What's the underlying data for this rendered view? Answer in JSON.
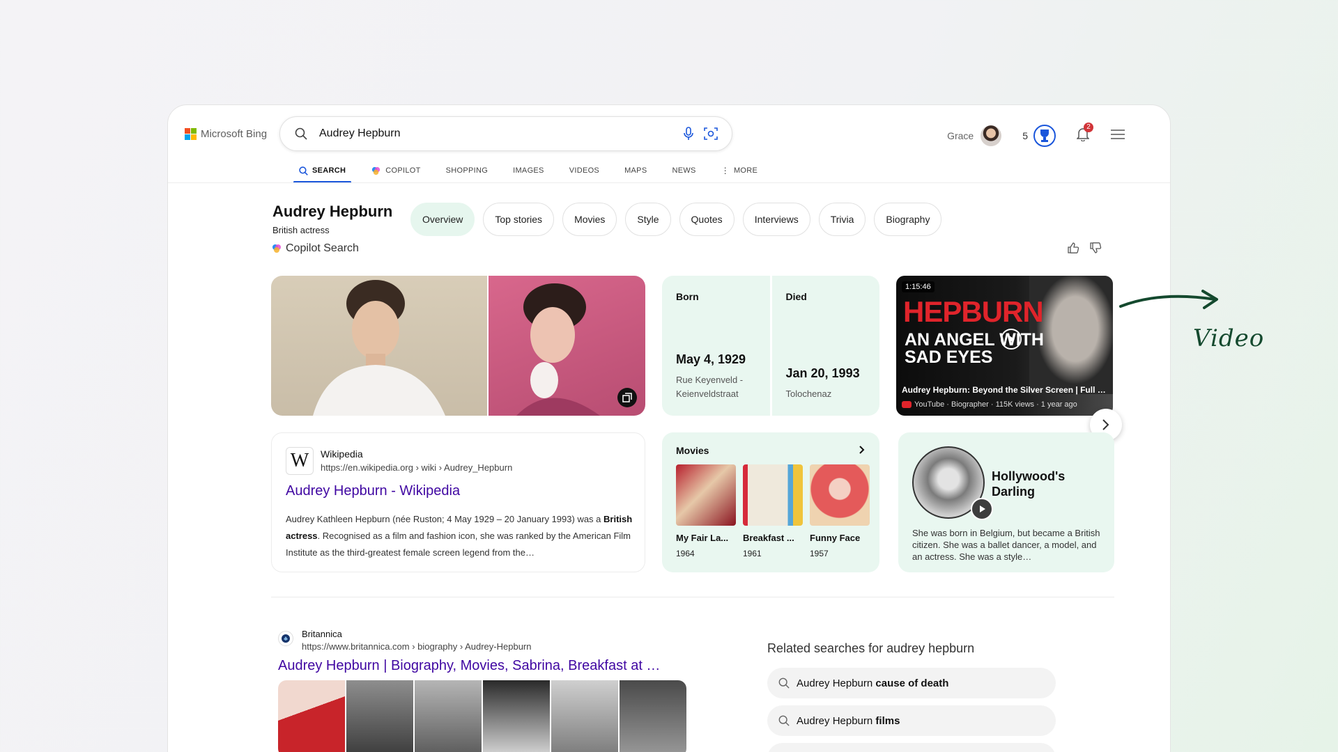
{
  "header": {
    "logo_text": "Microsoft Bing",
    "search_value": "Audrey Hepburn",
    "user_name": "Grace",
    "points": "5",
    "notification_count": "2"
  },
  "nav": {
    "tabs": [
      {
        "label": "SEARCH",
        "icon": "search-icon"
      },
      {
        "label": "COPILOT",
        "icon": "copilot-icon"
      },
      {
        "label": "SHOPPING"
      },
      {
        "label": "IMAGES"
      },
      {
        "label": "VIDEOS"
      },
      {
        "label": "MAPS"
      },
      {
        "label": "NEWS"
      },
      {
        "label": "MORE",
        "icon": "more-vertical-icon"
      }
    ]
  },
  "entity": {
    "name": "Audrey Hepburn",
    "subtitle": "British actress",
    "chips": [
      "Overview",
      "Top stories",
      "Movies",
      "Style",
      "Quotes",
      "Interviews",
      "Trivia",
      "Biography"
    ],
    "copilot_label": "Copilot Search"
  },
  "facts": {
    "born_label": "Born",
    "born_date": "May 4, 1929",
    "born_place": "Rue Keyenveld - Keienveldstraat",
    "died_label": "Died",
    "died_date": "Jan 20, 1993",
    "died_place": "Tolochenaz"
  },
  "video": {
    "duration": "1:15:46",
    "thumb_line1": "HEPBURN",
    "thumb_line2": "AN ANGEL WITH SAD EYES",
    "title": "Audrey Hepburn: Beyond the Silver Screen | Full Documentary",
    "meta": "YouTube · Biographer · 115K views · 1 year ago"
  },
  "wiki": {
    "site": "Wikipedia",
    "url": "https://en.wikipedia.org › wiki › Audrey_Hepburn",
    "title": "Audrey Hepburn - Wikipedia",
    "snippet_pre": "Audrey Kathleen Hepburn (née Ruston; 4 May 1929 – 20 January 1993) was a ",
    "snippet_bold": "British actress",
    "snippet_post": ". Recognised as a film and fashion icon, she was ranked by the American Film Institute as the third-greatest female screen legend from the…"
  },
  "movies": {
    "header": "Movies",
    "items": [
      {
        "title": "My Fair La...",
        "year": "1964",
        "color": "#b7202e"
      },
      {
        "title": "Breakfast ...",
        "year": "1961",
        "color": "#e9e1cf"
      },
      {
        "title": "Funny Face",
        "year": "1957",
        "color": "#e77a7a"
      }
    ]
  },
  "hollywood": {
    "title": "Hollywood's Darling",
    "text": "She was born in Belgium, but became a British citizen. She was a ballet dancer, a model, and an actress. She was a style…"
  },
  "britannica": {
    "site": "Britannica",
    "url": "https://www.britannica.com › biography › Audrey-Hepburn",
    "title": "Audrey Hepburn | Biography, Movies, Sabrina, Breakfast at …"
  },
  "related": {
    "title": "Related searches for audrey hepburn",
    "items": [
      {
        "prefix": "Audrey Hepburn ",
        "bold": "cause of death"
      },
      {
        "prefix": "Audrey Hepburn ",
        "bold": "films"
      }
    ]
  },
  "annotation": {
    "label": "Video"
  },
  "colors": {
    "accent_blue": "#1a56db",
    "link_purple": "#4007a2",
    "card_green": "#e9f7f0",
    "chip_active": "#e6f6ee",
    "annotation_green": "#14492e",
    "badge_red": "#d13438"
  }
}
